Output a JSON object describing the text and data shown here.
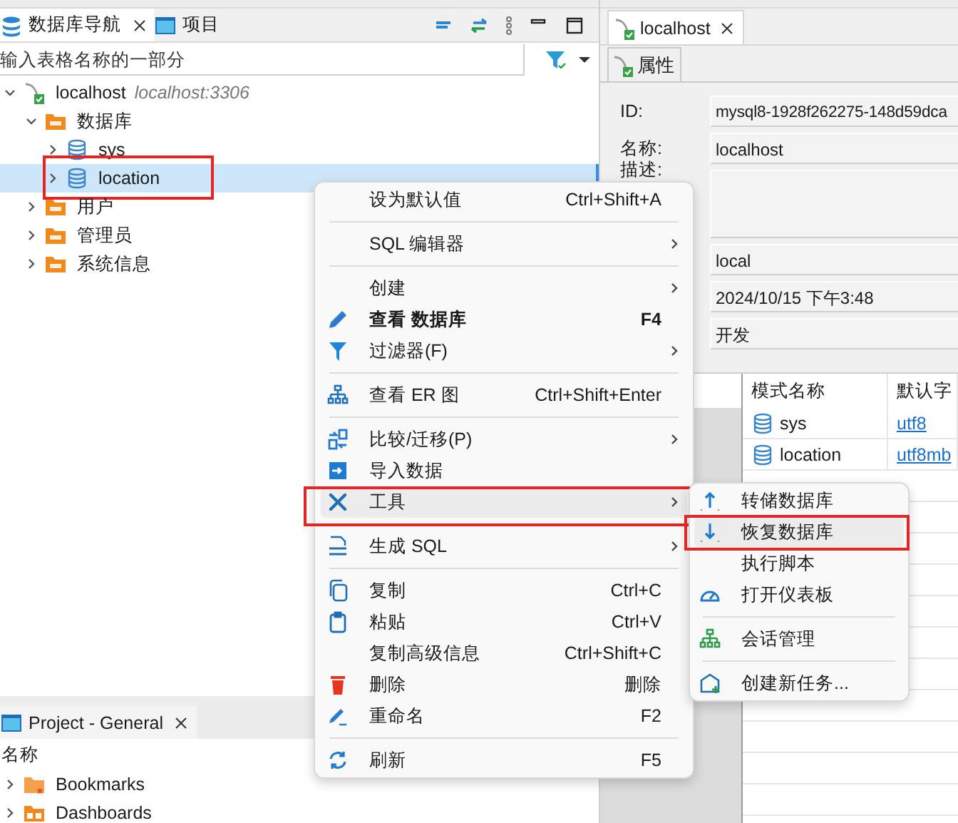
{
  "navigator": {
    "tabs": [
      {
        "label": "数据库导航",
        "selected": true,
        "closable": true
      },
      {
        "label": "项目",
        "selected": false,
        "closable": false
      }
    ],
    "filter": {
      "placeholder": "输入表格名称的一部分"
    },
    "tree": [
      {
        "kind": "connection",
        "label": "localhost",
        "detail": "localhost:3306",
        "expanded": true,
        "selected": false,
        "marked": false,
        "children": [
          {
            "kind": "folder",
            "label": "数据库",
            "expanded": true,
            "selected": false,
            "marked": false,
            "children": [
              {
                "kind": "database",
                "label": "sys",
                "expanded": false,
                "selected": false,
                "marked": false
              },
              {
                "kind": "database",
                "label": "location",
                "expanded": false,
                "selected": true,
                "marked": true
              }
            ]
          },
          {
            "kind": "folder",
            "label": "用户",
            "expanded": false,
            "selected": false,
            "marked": false
          },
          {
            "kind": "folder",
            "label": "管理员",
            "expanded": false,
            "selected": false,
            "marked": false
          },
          {
            "kind": "folder",
            "label": "系统信息",
            "expanded": false,
            "selected": false,
            "marked": false
          }
        ]
      }
    ]
  },
  "project_panel": {
    "tab": {
      "label": "Project - General"
    },
    "column": "名称",
    "items": [
      {
        "label": "Bookmarks",
        "expanded": false
      },
      {
        "label": "Dashboards",
        "expanded": false
      }
    ]
  },
  "editor": {
    "tab": {
      "label": "localhost"
    },
    "subtab": {
      "label": "属性"
    },
    "fields": [
      {
        "kind": "line",
        "label": "ID:",
        "value": "mysql8-1928f262275-148d59dca"
      },
      {
        "kind": "line",
        "label": "名称:",
        "value": "localhost"
      },
      {
        "kind": "area",
        "label": "描述:"
      },
      {
        "kind": "line",
        "value": "local"
      },
      {
        "kind": "line",
        "value": "2024/10/15 下午3:48"
      },
      {
        "kind": "line",
        "value": "开发"
      }
    ],
    "schema_table": {
      "columns": [
        "模式名称",
        "默认字"
      ],
      "rows": [
        {
          "name": "sys",
          "charset": "utf8"
        },
        {
          "name": "location",
          "charset": "utf8mb"
        }
      ]
    }
  },
  "context_menu": {
    "groups": [
      [
        {
          "label": "设为默认值",
          "shortcut": "Ctrl+Shift+A",
          "submenu": false,
          "default": false,
          "selected": false,
          "marked": false
        }
      ],
      [
        {
          "label": "SQL 编辑器",
          "submenu": true,
          "default": false,
          "selected": false,
          "marked": false
        }
      ],
      [
        {
          "label": "创建",
          "submenu": true,
          "default": false,
          "selected": false,
          "marked": false
        },
        {
          "label": "查看 数据库",
          "shortcut": "F4",
          "submenu": false,
          "default": true,
          "selected": false,
          "marked": false
        },
        {
          "label": "过滤器(F)",
          "submenu": true,
          "default": false,
          "selected": false,
          "marked": false
        }
      ],
      [
        {
          "label": "查看 ER 图",
          "shortcut": "Ctrl+Shift+Enter",
          "submenu": false,
          "default": false,
          "selected": false,
          "marked": false
        }
      ],
      [
        {
          "label": "比较/迁移(P)",
          "submenu": true,
          "default": false,
          "selected": false,
          "marked": false
        },
        {
          "label": "导入数据",
          "submenu": false,
          "default": false,
          "selected": false,
          "marked": false
        },
        {
          "label": "工具",
          "submenu": true,
          "default": false,
          "selected": true,
          "marked": true
        }
      ],
      [
        {
          "label": "生成 SQL",
          "submenu": true,
          "default": false,
          "selected": false,
          "marked": false
        }
      ],
      [
        {
          "label": "复制",
          "shortcut": "Ctrl+C",
          "submenu": false,
          "default": false,
          "selected": false,
          "marked": false
        },
        {
          "label": "粘贴",
          "shortcut": "Ctrl+V",
          "submenu": false,
          "default": false,
          "selected": false,
          "marked": false
        },
        {
          "label": "复制高级信息",
          "shortcut": "Ctrl+Shift+C",
          "submenu": false,
          "default": false,
          "selected": false,
          "marked": false
        },
        {
          "label": "删除",
          "shortcut": "删除",
          "submenu": false,
          "default": false,
          "selected": false,
          "marked": false
        },
        {
          "label": "重命名",
          "shortcut": "F2",
          "submenu": false,
          "default": false,
          "selected": false,
          "marked": false
        }
      ],
      [
        {
          "label": "刷新",
          "shortcut": "F5",
          "submenu": false,
          "default": false,
          "selected": false,
          "marked": false
        }
      ]
    ]
  },
  "tools_submenu": {
    "groups": [
      [
        {
          "label": "转储数据库",
          "selected": false,
          "marked": false
        },
        {
          "label": "恢复数据库",
          "selected": true,
          "marked": true
        },
        {
          "label": "执行脚本",
          "selected": false,
          "marked": false
        },
        {
          "label": "打开仪表板",
          "selected": false,
          "marked": false
        }
      ],
      [
        {
          "label": "会话管理",
          "selected": false,
          "marked": false
        }
      ],
      [
        {
          "label": "创建新任务...",
          "selected": false,
          "marked": false
        }
      ]
    ]
  }
}
